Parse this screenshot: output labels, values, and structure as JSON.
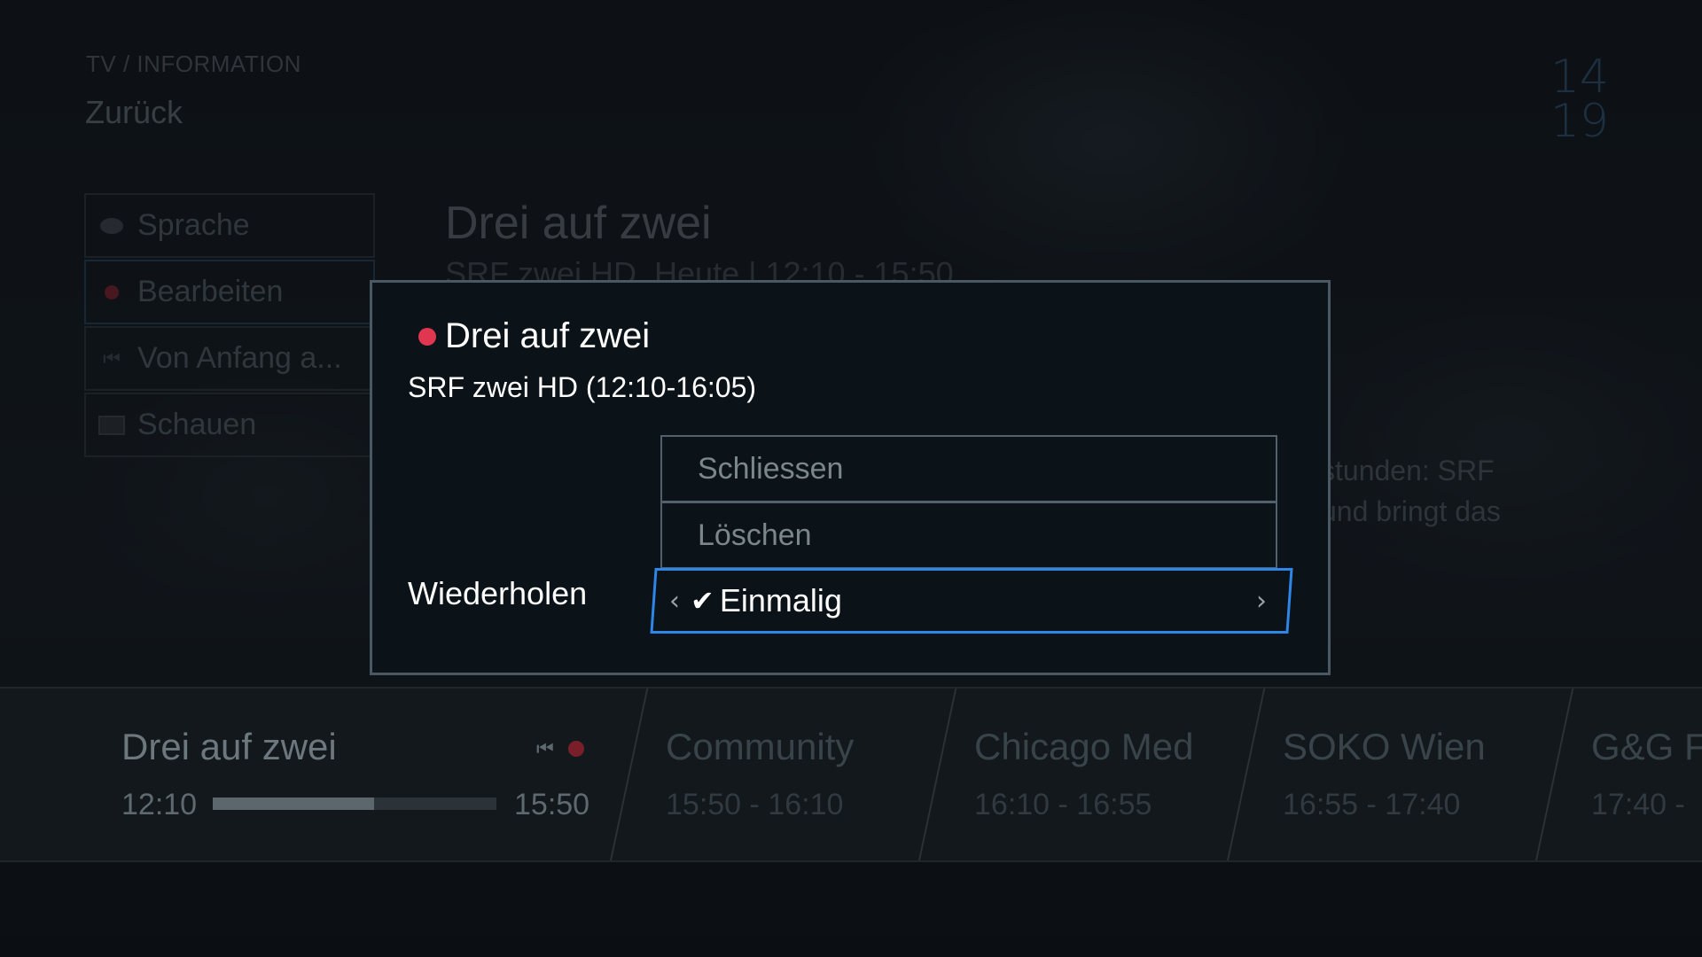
{
  "header": {
    "breadcrumb": "TV / INFORMATION",
    "back_label": "Zurück",
    "clock_hour": "14",
    "clock_minute": "19"
  },
  "side_menu": {
    "items": [
      {
        "label": "Sprache",
        "icon": "speech-bubble-icon"
      },
      {
        "label": "Bearbeiten",
        "icon": "record-dot-icon",
        "selected": true
      },
      {
        "label": "Von Anfang a...",
        "icon": "restart-icon"
      },
      {
        "label": "Schauen",
        "icon": "tv-icon"
      }
    ]
  },
  "background_program": {
    "title": "Drei auf zwei",
    "subtitle": "SRF zwei HD, Heute | 12:10 - 15:50",
    "description_lines": [
      "stunden: SRF",
      "und bringt das"
    ]
  },
  "schedule": {
    "current": {
      "title": "Drei auf zwei",
      "start": "12:10",
      "end": "15:50",
      "progress": 0.57
    },
    "upcoming": [
      {
        "title": "Community",
        "time": "15:50 - 16:10"
      },
      {
        "title": "Chicago Med",
        "time": "16:10 - 16:55"
      },
      {
        "title": "SOKO Wien",
        "time": "16:55 - 17:40"
      },
      {
        "title": "G&G F",
        "time": "17:40 -"
      }
    ]
  },
  "dialog": {
    "title": "Drei auf zwei",
    "subtitle": "SRF zwei HD (12:10-16:05)",
    "options": [
      "Schliessen",
      "Löschen"
    ],
    "repeat_label": "Wiederholen",
    "repeat_value": "Einmalig",
    "accent_color": "#2d86e8",
    "record_color": "#e0364f"
  }
}
